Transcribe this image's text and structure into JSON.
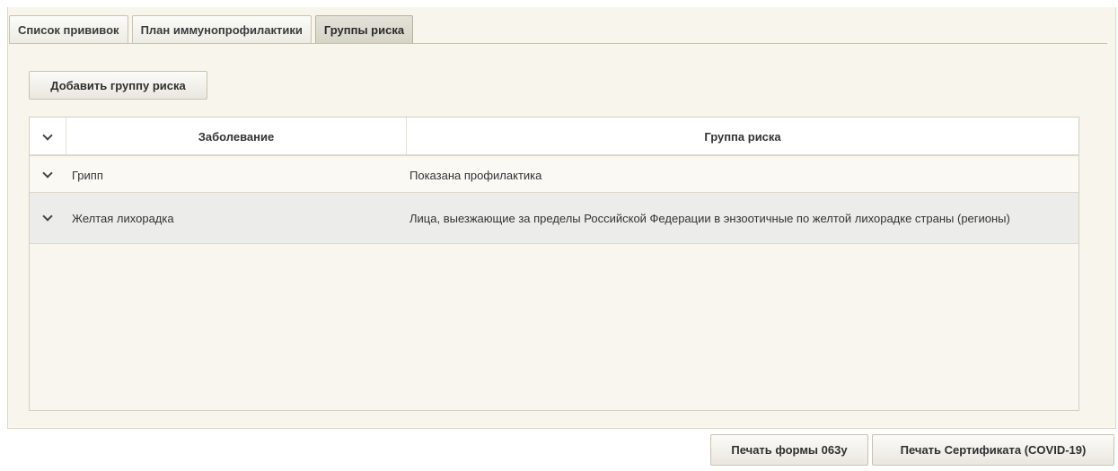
{
  "tabs": [
    {
      "label": "Список прививок",
      "active": false
    },
    {
      "label": "План иммунопрофилактики",
      "active": false
    },
    {
      "label": "Группы риска",
      "active": true
    }
  ],
  "toolbar": {
    "add_label": "Добавить группу риска"
  },
  "table": {
    "columns": [
      "Заболевание",
      "Группа риска"
    ],
    "rows": [
      {
        "disease": "Грипп",
        "risk_group": "Показана профилактика"
      },
      {
        "disease": "Желтая лихорадка",
        "risk_group": "Лица, выезжающие за пределы Российской Федерации в энзоотичные по желтой лихорадке страны (регионы)"
      }
    ]
  },
  "footer": {
    "print_063_label": "Печать формы 063у",
    "print_covid_label": "Печать Сертификата (COVID-19)"
  },
  "icons": {
    "expand": "chevron-down-icon"
  },
  "colors": {
    "panel_bg": "#f8f5ec",
    "border": "#c9c2ae",
    "row_alt": "#ececea"
  }
}
